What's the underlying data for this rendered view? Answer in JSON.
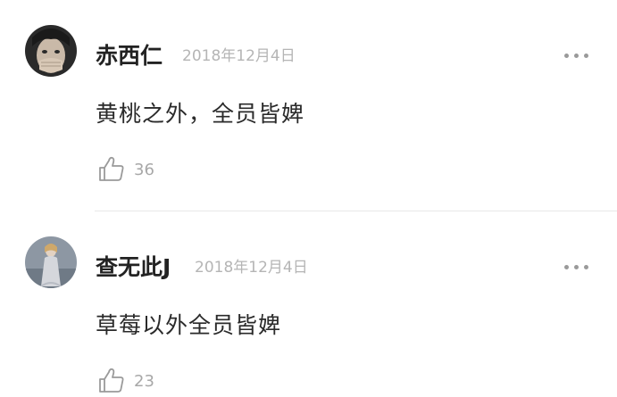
{
  "comments": [
    {
      "username": "赤西仁",
      "date": "2018年12月4日",
      "text": "黄桃之外，全员皆婢",
      "likes": "36",
      "avatar": "avatar-man-hand-over-mouth"
    },
    {
      "username": "查无此J",
      "date": "2018年12月4日",
      "text": "草莓以外全员皆婢",
      "likes": "23",
      "avatar": "avatar-woman-gown"
    }
  ],
  "icons": {
    "more": "more-icon",
    "like": "thumbs-up-icon"
  },
  "colors": {
    "name": "#222222",
    "date": "#b5b5b5",
    "text": "#2a2a2a",
    "icon": "#9a9a9a",
    "divider": "#e8e8e8"
  }
}
